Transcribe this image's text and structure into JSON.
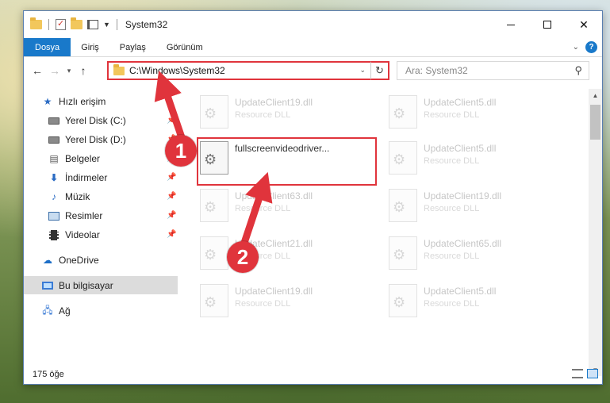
{
  "window": {
    "title": "System32"
  },
  "ribbon": {
    "tabs": [
      "Dosya",
      "Giriş",
      "Paylaş",
      "Görünüm"
    ]
  },
  "address": {
    "path": "C:\\Windows\\System32"
  },
  "search": {
    "placeholder": "Ara: System32"
  },
  "sidebar": {
    "items": [
      {
        "label": "Hızlı erişim",
        "icon": "star-icon",
        "pinned": false
      },
      {
        "label": "Yerel Disk (C:)",
        "icon": "disk-icon",
        "pinned": true
      },
      {
        "label": "Yerel Disk (D:)",
        "icon": "disk-icon",
        "pinned": true
      },
      {
        "label": "Belgeler",
        "icon": "documents-icon",
        "pinned": true
      },
      {
        "label": "İndirmeler",
        "icon": "downloads-icon",
        "pinned": true
      },
      {
        "label": "Müzik",
        "icon": "music-icon",
        "pinned": true
      },
      {
        "label": "Resimler",
        "icon": "pictures-icon",
        "pinned": true
      },
      {
        "label": "Videolar",
        "icon": "videos-icon",
        "pinned": true
      },
      {
        "label": "OneDrive",
        "icon": "cloud-icon",
        "pinned": false
      },
      {
        "label": "Bu bilgisayar",
        "icon": "computer-icon",
        "pinned": false,
        "selected": true
      },
      {
        "label": "Ağ",
        "icon": "network-icon",
        "pinned": false
      }
    ]
  },
  "files": [
    {
      "name": "UpdateClient19.dll",
      "type": "Resource DLL",
      "faded": true
    },
    {
      "name": "UpdateClient5.dll",
      "type": "Resource DLL",
      "faded": true
    },
    {
      "name": "fullscreenvideodriver...",
      "type": "",
      "faded": false
    },
    {
      "name": "UpdateClient5.dll",
      "type": "Resource DLL",
      "faded": true
    },
    {
      "name": "UpdateClient63.dll",
      "type": "Resource DLL",
      "faded": true
    },
    {
      "name": "UpdateClient19.dll",
      "type": "Resource DLL",
      "faded": true
    },
    {
      "name": "UpdateClient21.dll",
      "type": "Resource DLL",
      "faded": true
    },
    {
      "name": "UpdateClient65.dll",
      "type": "Resource DLL",
      "faded": true
    },
    {
      "name": "UpdateClient19.dll",
      "type": "Resource DLL",
      "faded": true
    },
    {
      "name": "UpdateClient5.dll",
      "type": "Resource DLL",
      "faded": true
    }
  ],
  "status": {
    "item_count": "175 öğe"
  },
  "annotations": {
    "step1": "1",
    "step2": "2",
    "color": "#e0343c"
  },
  "colors": {
    "accent": "#1979ca",
    "highlight": "#e0343c"
  }
}
